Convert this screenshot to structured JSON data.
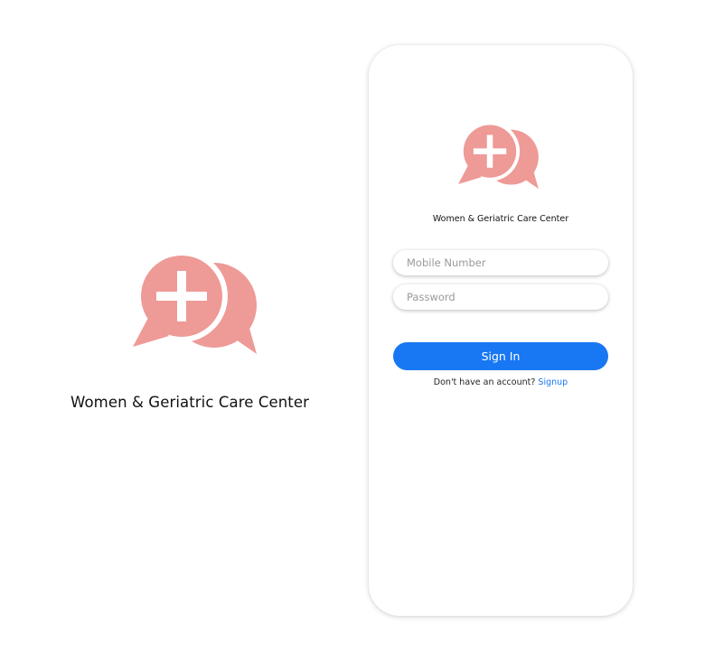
{
  "brand": {
    "name": "Women & Geriatric Care Center",
    "logo_icon": "medical-chat-bubbles-icon",
    "logo_color": "#ee9a97"
  },
  "login": {
    "mobile_placeholder": "Mobile Number",
    "password_placeholder": "Password",
    "signin_label": "Sign In",
    "no_account_text": "Don't have an account?",
    "signup_label": "Signup",
    "accent_color": "#1877f2"
  }
}
